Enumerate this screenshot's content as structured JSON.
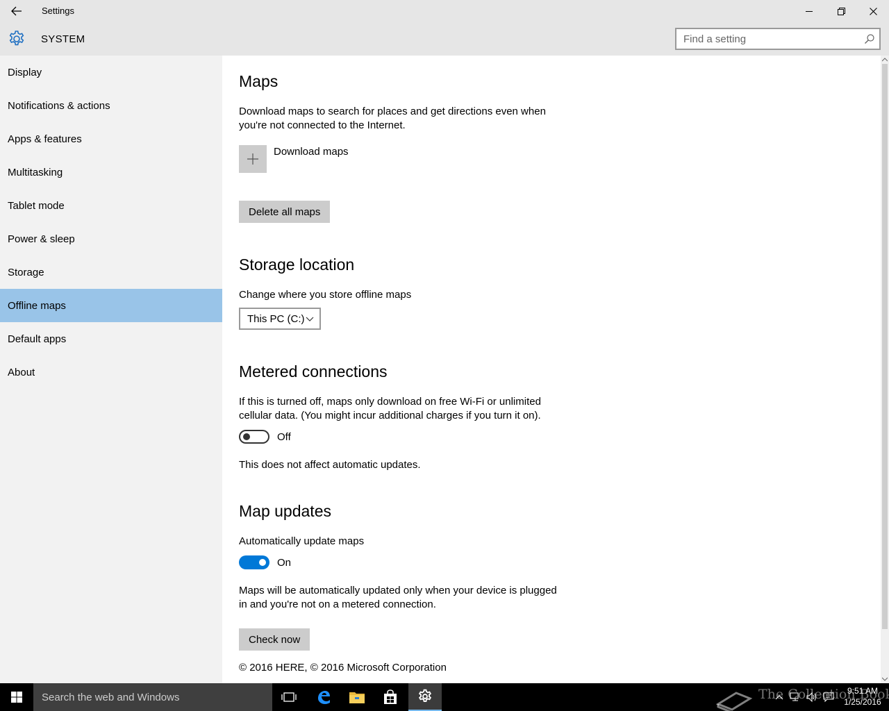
{
  "window": {
    "title": "Settings",
    "controls": {
      "minimize": "minimize-icon",
      "maximize": "restore-icon",
      "close": "close-icon"
    }
  },
  "header": {
    "title": "SYSTEM",
    "search_placeholder": "Find a setting"
  },
  "sidebar": {
    "items": [
      {
        "label": "Display"
      },
      {
        "label": "Notifications & actions"
      },
      {
        "label": "Apps & features"
      },
      {
        "label": "Multitasking"
      },
      {
        "label": "Tablet mode"
      },
      {
        "label": "Power & sleep"
      },
      {
        "label": "Storage"
      },
      {
        "label": "Offline maps",
        "active": true
      },
      {
        "label": "Default apps"
      },
      {
        "label": "About"
      }
    ]
  },
  "maps": {
    "heading": "Maps",
    "description": "Download maps to search for places and get directions even when you're not connected to the Internet.",
    "download_label": "Download maps",
    "delete_label": "Delete all maps"
  },
  "storage": {
    "heading": "Storage location",
    "description": "Change where you store offline maps",
    "selected": "This PC (C:)"
  },
  "metered": {
    "heading": "Metered connections",
    "description": "If this is turned off, maps only download on free Wi-Fi or unlimited cellular data. (You might incur additional charges if you turn it on).",
    "toggle_state": "Off",
    "note": "This does not affect automatic updates."
  },
  "updates": {
    "heading": "Map updates",
    "auto_label": "Automatically update maps",
    "toggle_state": "On",
    "description": "Maps will be automatically updated only when your device is plugged in and you're not on a metered connection.",
    "check_label": "Check now",
    "copyright": "© 2016 HERE, © 2016 Microsoft Corporation"
  },
  "taskbar": {
    "search_placeholder": "Search the web and Windows",
    "time": "9:51 AM",
    "date": "1/25/2016",
    "watermark": "The Collection Book"
  },
  "colors": {
    "accent": "#0078d7",
    "nav_active": "#99c4e8",
    "chrome": "#e6e6e6",
    "sidebar": "#f2f2f2"
  }
}
